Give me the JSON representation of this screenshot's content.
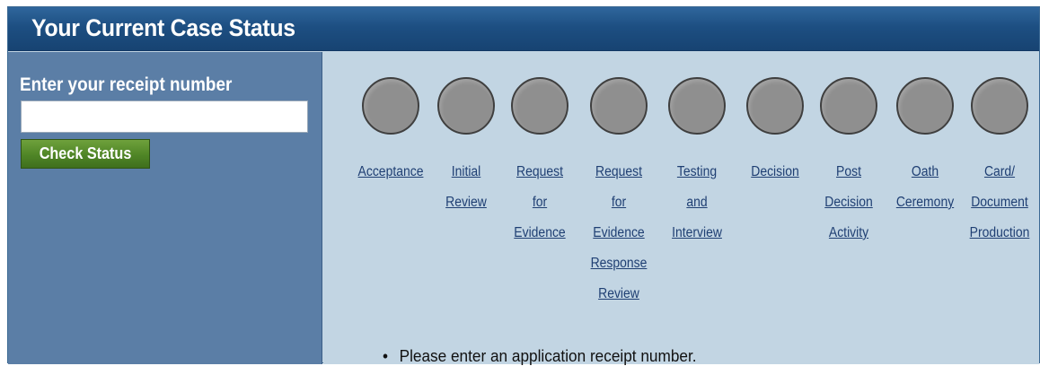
{
  "header": {
    "title": "Your Current Case Status"
  },
  "receipt": {
    "label": "Enter your receipt number",
    "value": "",
    "placeholder": "",
    "button_label": "Check Status"
  },
  "steps": [
    {
      "lines": [
        "Acceptance"
      ]
    },
    {
      "lines": [
        "Initial",
        "Review"
      ]
    },
    {
      "lines": [
        "Request",
        "for",
        "Evidence"
      ]
    },
    {
      "lines": [
        "Request",
        "for",
        "Evidence",
        "Response",
        "Review"
      ]
    },
    {
      "lines": [
        "Testing",
        "and",
        "Interview"
      ]
    },
    {
      "lines": [
        "Decision"
      ]
    },
    {
      "lines": [
        "Post",
        "Decision",
        "Activity"
      ]
    },
    {
      "lines": [
        "Oath",
        "Ceremony"
      ]
    },
    {
      "lines": [
        "Card/",
        "Document",
        "Production"
      ]
    }
  ],
  "message": {
    "bullet": "•",
    "text": "Please enter an application receipt number."
  },
  "colors": {
    "header_bg": "#1d4f82",
    "left_panel_bg": "#5b7ea6",
    "right_panel_bg": "#c2d5e3",
    "button_green": "#4f8526",
    "step_circle": "#8f8f8f",
    "link": "#1f3f73"
  }
}
